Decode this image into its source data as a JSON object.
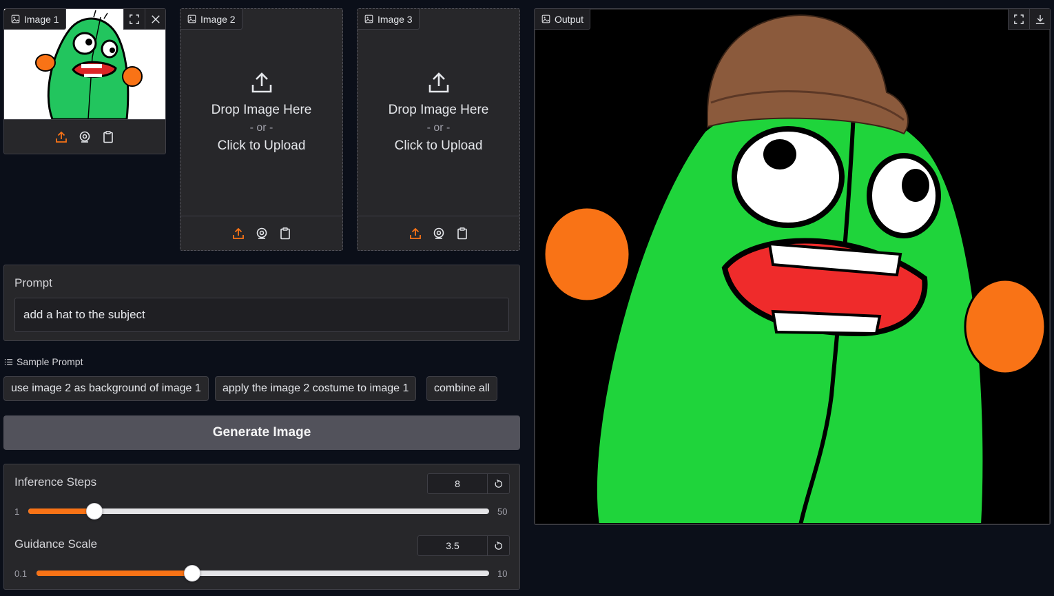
{
  "image_inputs": [
    {
      "label": "Image 1",
      "has_image": true
    },
    {
      "label": "Image 2",
      "drop_text": "Drop Image Here",
      "or_text": "- or -",
      "click_text": "Click to Upload"
    },
    {
      "label": "Image 3",
      "drop_text": "Drop Image Here",
      "or_text": "- or -",
      "click_text": "Click to Upload"
    }
  ],
  "output": {
    "label": "Output"
  },
  "prompt": {
    "label": "Prompt",
    "value": "add a hat to the subject"
  },
  "samples": {
    "heading": "Sample Prompt",
    "items": [
      "use image 2 as background of image 1",
      "apply the image 2 costume to image 1",
      "combine all"
    ]
  },
  "generate_button": "Generate Image",
  "inference_steps": {
    "label": "Inference Steps",
    "value": "8",
    "min": "1",
    "max": "50",
    "fraction": 0.1429
  },
  "guidance_scale": {
    "label": "Guidance Scale",
    "value": "3.5",
    "min": "0.1",
    "max": "10",
    "fraction": 0.3434
  },
  "colors": {
    "accent": "#f97316",
    "panel": "#27272a",
    "background": "#0b0f19",
    "button": "#52525b"
  },
  "icons": [
    "image-icon",
    "fullscreen-icon",
    "close-icon",
    "upload-icon",
    "webcam-icon",
    "clipboard-icon",
    "reset-icon",
    "download-icon",
    "list-icon"
  ]
}
